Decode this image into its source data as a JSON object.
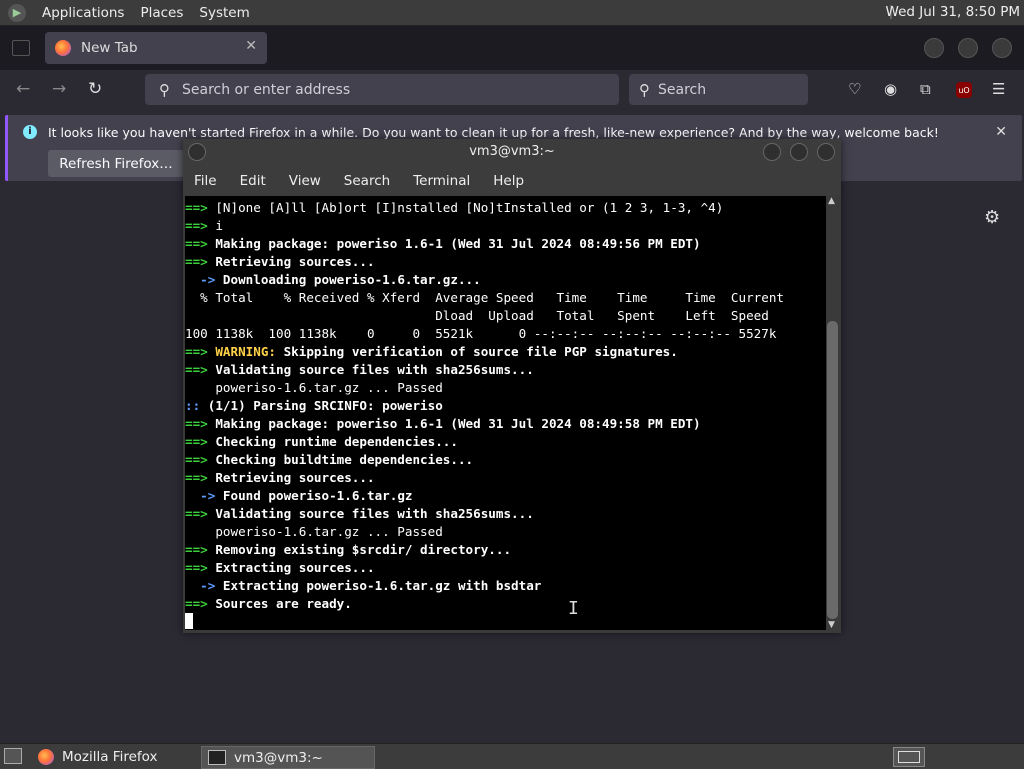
{
  "top_panel": {
    "menus": [
      "Applications",
      "Places",
      "System"
    ],
    "clock": "Wed Jul 31,  8:50 PM"
  },
  "firefox": {
    "tab_title": "New Tab",
    "url_placeholder": "Search or enter address",
    "search_placeholder": "Search",
    "notification_message": "It looks like you haven't started Firefox in a while. Do you want to clean it up for a fresh, like-new experience? And by the way, welcome back!",
    "refresh_button": "Refresh Firefox…"
  },
  "terminal": {
    "title": "vm3@vm3:~",
    "menu": [
      "File",
      "Edit",
      "View",
      "Search",
      "Terminal",
      "Help"
    ],
    "lines": [
      {
        "m": "==>",
        "t": " [N]one [A]ll [Ab]ort [I]nstalled [No]tInstalled or (1 2 3, 1-3, ^4)",
        "s": "n"
      },
      {
        "m": "==>",
        "t": " i",
        "s": "n"
      },
      {
        "m": "==>",
        "t": " Making package: poweriso 1.6-1 (Wed 31 Jul 2024 08:49:56 PM EDT)",
        "s": "b"
      },
      {
        "m": "==>",
        "t": " Retrieving sources...",
        "s": "b"
      },
      {
        "m": "  ->",
        "t": " Downloading poweriso-1.6.tar.gz...",
        "s": "sub"
      },
      {
        "m": "",
        "t": "  % Total    % Received % Xferd  Average Speed   Time    Time     Time  Current",
        "s": "n"
      },
      {
        "m": "",
        "t": "                                 Dload  Upload   Total   Spent    Left  Speed",
        "s": "n"
      },
      {
        "m": "",
        "t": "100 1138k  100 1138k    0     0  5521k      0 --:--:-- --:--:-- --:--:-- 5527k",
        "s": "n"
      },
      {
        "m": "==>",
        "t": " WARNING:",
        "t2": " Skipping verification of source file PGP signatures.",
        "s": "warn"
      },
      {
        "m": "==>",
        "t": " Validating source files with sha256sums...",
        "s": "b"
      },
      {
        "m": "",
        "t": "    poweriso-1.6.tar.gz ... Passed",
        "s": "n"
      },
      {
        "m": "::",
        "t": " (1/1) Parsing SRCINFO: poweriso",
        "s": "b"
      },
      {
        "m": "==>",
        "t": " Making package: poweriso 1.6-1 (Wed 31 Jul 2024 08:49:58 PM EDT)",
        "s": "b"
      },
      {
        "m": "==>",
        "t": " Checking runtime dependencies...",
        "s": "b"
      },
      {
        "m": "==>",
        "t": " Checking buildtime dependencies...",
        "s": "b"
      },
      {
        "m": "==>",
        "t": " Retrieving sources...",
        "s": "b"
      },
      {
        "m": "  ->",
        "t": " Found poweriso-1.6.tar.gz",
        "s": "sub"
      },
      {
        "m": "==>",
        "t": " Validating source files with sha256sums...",
        "s": "b"
      },
      {
        "m": "",
        "t": "    poweriso-1.6.tar.gz ... Passed",
        "s": "n"
      },
      {
        "m": "==>",
        "t": " Removing existing $srcdir/ directory...",
        "s": "b"
      },
      {
        "m": "==>",
        "t": " Extracting sources...",
        "s": "b"
      },
      {
        "m": "  ->",
        "t": " Extracting poweriso-1.6.tar.gz with bsdtar",
        "s": "sub"
      },
      {
        "m": "==>",
        "t": " Sources are ready.",
        "s": "b"
      }
    ]
  },
  "taskbar": {
    "items": [
      "Mozilla Firefox",
      "vm3@vm3:~"
    ]
  }
}
